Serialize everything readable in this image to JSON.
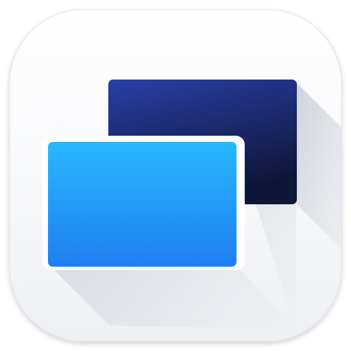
{
  "app_icon": {
    "icon_name": "dual-display-windows-icon",
    "colors": {
      "tile_top": "#ffffff",
      "tile_bottom": "#eef0f4",
      "tile_edge": "#e3e5ea",
      "back_window_top": "#2a3fa6",
      "back_window_bottom": "#0e1638",
      "front_window_top": "#27b8ff",
      "front_window_bottom": "#1f7ff2",
      "front_window_border": "#ffffff",
      "shadow": "#c9ccd6"
    }
  }
}
